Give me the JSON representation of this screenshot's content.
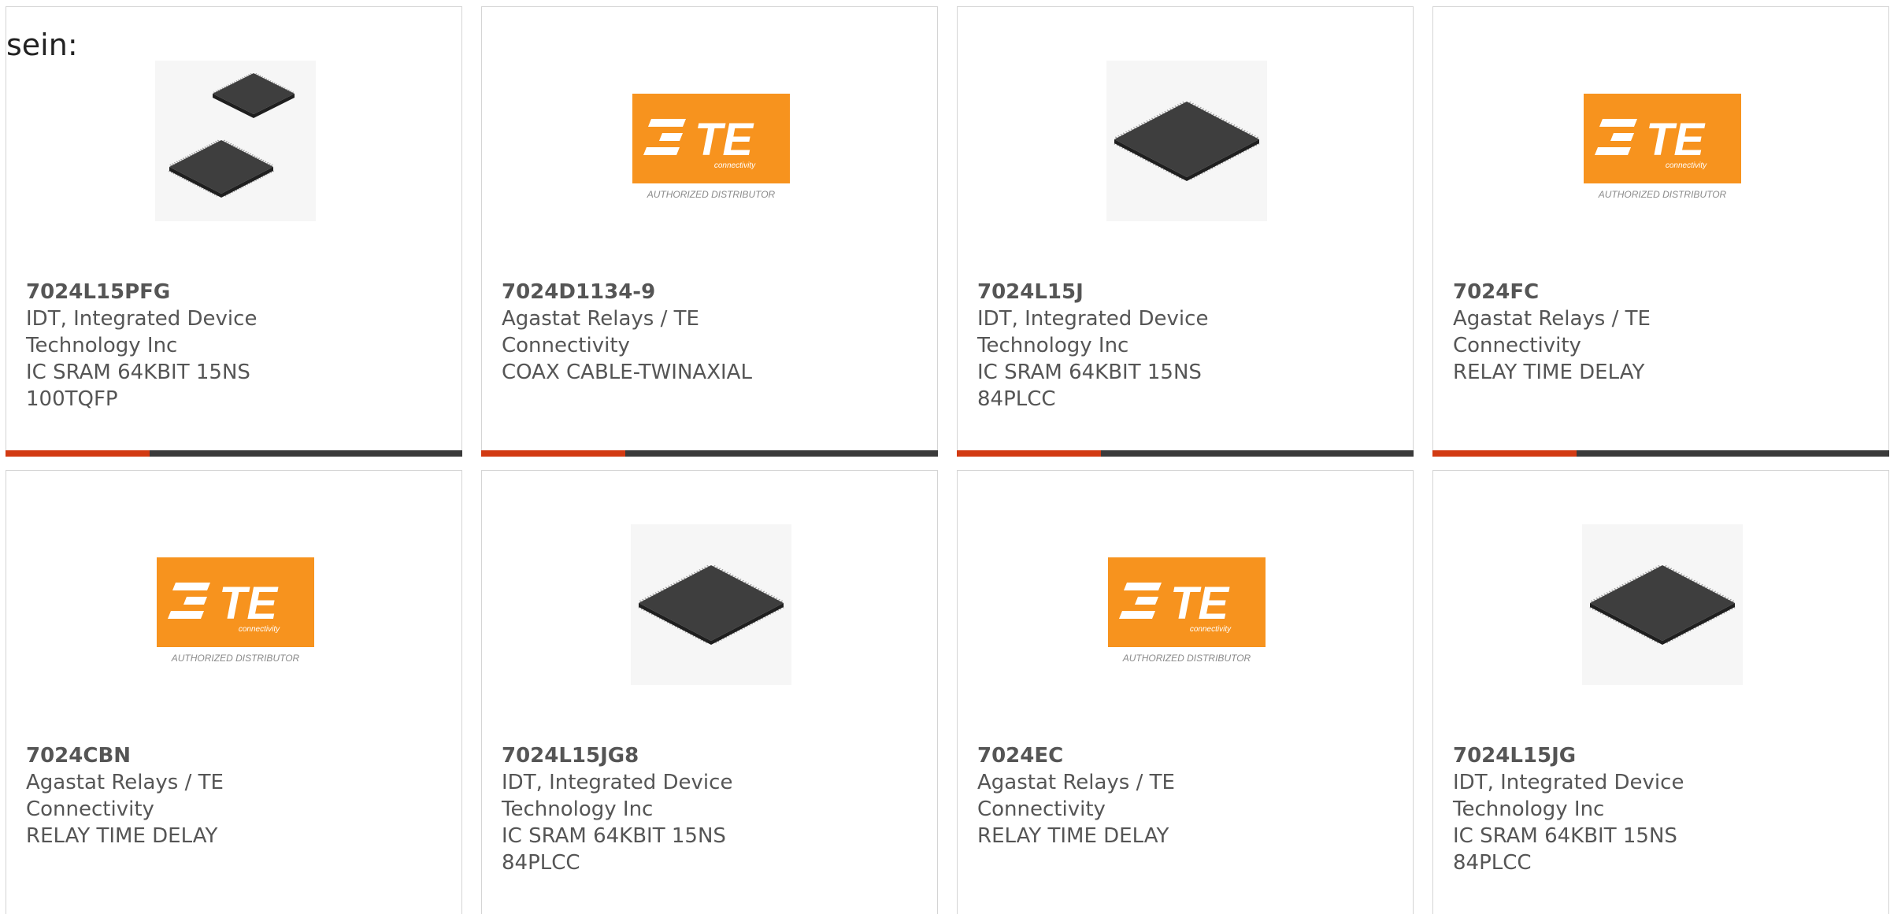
{
  "intro": {
    "text": "sein:"
  },
  "colors": {
    "card_border": "#d4d4d4",
    "bar_dark": "#3a3a3a",
    "bar_accent": "#d23a12",
    "te_orange": "#f7931e"
  },
  "te_logo": {
    "brand": "TE",
    "sub": "connectivity",
    "tagline": "AUTHORIZED DISTRIBUTOR"
  },
  "products": [
    {
      "part": "7024L15PFG",
      "maker": "IDT, Integrated Device Technology Inc",
      "desc": "IC SRAM 64KBIT 15NS 100TQFP",
      "image": "tqfp-chip-pair-icon"
    },
    {
      "part": "7024D1134-9",
      "maker": "Agastat Relays / TE Connectivity",
      "desc": "COAX CABLE-TWINAXIAL",
      "image": "te-authorized-distributor-logo"
    },
    {
      "part": "7024L15J",
      "maker": "IDT, Integrated Device Technology Inc",
      "desc": "IC SRAM 64KBIT 15NS 84PLCC",
      "image": "plcc-chip-icon"
    },
    {
      "part": "7024FC",
      "maker": "Agastat Relays / TE Connectivity",
      "desc": "RELAY TIME DELAY",
      "image": "te-authorized-distributor-logo"
    },
    {
      "part": "7024CBN",
      "maker": "Agastat Relays / TE Connectivity",
      "desc": "RELAY TIME DELAY",
      "image": "te-authorized-distributor-logo"
    },
    {
      "part": "7024L15JG8",
      "maker": "IDT, Integrated Device Technology Inc",
      "desc": "IC SRAM 64KBIT 15NS 84PLCC",
      "image": "plcc-chip-icon"
    },
    {
      "part": "7024EC",
      "maker": "Agastat Relays / TE Connectivity",
      "desc": "RELAY TIME DELAY",
      "image": "te-authorized-distributor-logo"
    },
    {
      "part": "7024L15JG",
      "maker": "IDT, Integrated Device Technology Inc",
      "desc": "IC SRAM 64KBIT 15NS 84PLCC",
      "image": "plcc-chip-icon"
    }
  ]
}
